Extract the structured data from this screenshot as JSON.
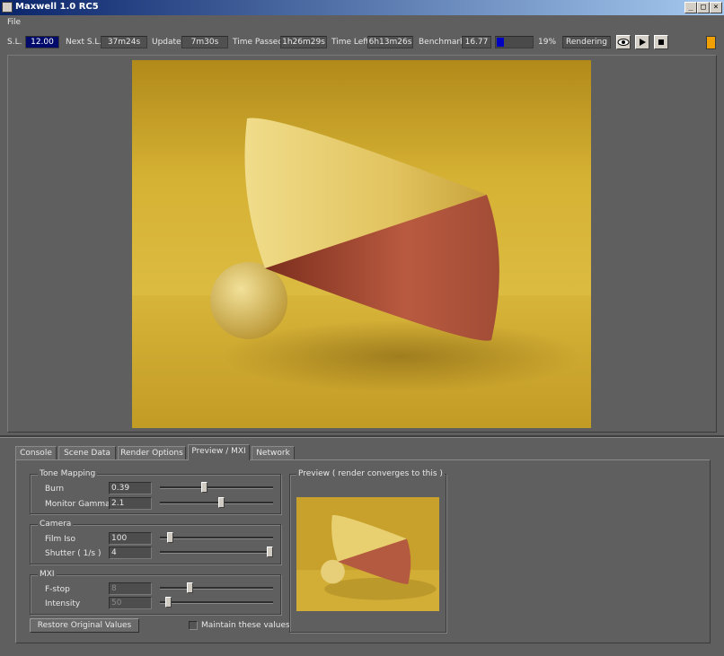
{
  "window": {
    "title": "Maxwell 1.0 RC5",
    "min": "_",
    "max": "□",
    "close": "×"
  },
  "menu": {
    "file": "File"
  },
  "toolbar": {
    "sl_label": "S.L.",
    "sl_value": "12.00",
    "next_sl_label": "Next S.L.",
    "next_sl_value": "37m24s",
    "update_label": "Update",
    "update_value": "7m30s",
    "time_passed_label": "Time Passed",
    "time_passed_value": "1h26m29s",
    "time_left_label": "Time Left",
    "time_left_value": "6h13m26s",
    "benchmark_label": "Benchmark",
    "benchmark_value": "16.77",
    "progress_percent": 19,
    "progress_text": "19%",
    "status": "Rendering",
    "progress_color": "#0000c0",
    "status_indicator_color": "#f0a000",
    "icons": [
      "eye-icon",
      "play-icon",
      "stop-icon"
    ]
  },
  "tabs": [
    {
      "label": "Console",
      "active": false
    },
    {
      "label": "Scene Data",
      "active": false
    },
    {
      "label": "Render Options",
      "active": false
    },
    {
      "label": "Preview / MXI",
      "active": true
    },
    {
      "label": "Network",
      "active": false
    }
  ],
  "tone_mapping": {
    "title": "Tone Mapping",
    "burn": {
      "label": "Burn",
      "value": "0.39",
      "slider": 0.39
    },
    "gamma": {
      "label": "Monitor Gamma",
      "value": "2.1",
      "slider": 0.55
    }
  },
  "camera": {
    "title": "Camera",
    "film_iso": {
      "label": "Film Iso",
      "value": "100",
      "slider": 0.07
    },
    "shutter": {
      "label": "Shutter ( 1/s )",
      "value": "4",
      "slider": 1.0
    }
  },
  "mxi": {
    "title": "MXI",
    "fstop": {
      "label": "F-stop",
      "value": "8",
      "slider": 0.25
    },
    "intensity": {
      "label": "Intensity",
      "value": "50",
      "slider": 0.05
    }
  },
  "actions": {
    "restore": "Restore Original Values",
    "maintain": "Maintain these values"
  },
  "preview": {
    "title": "Preview ( render converges to this )"
  }
}
